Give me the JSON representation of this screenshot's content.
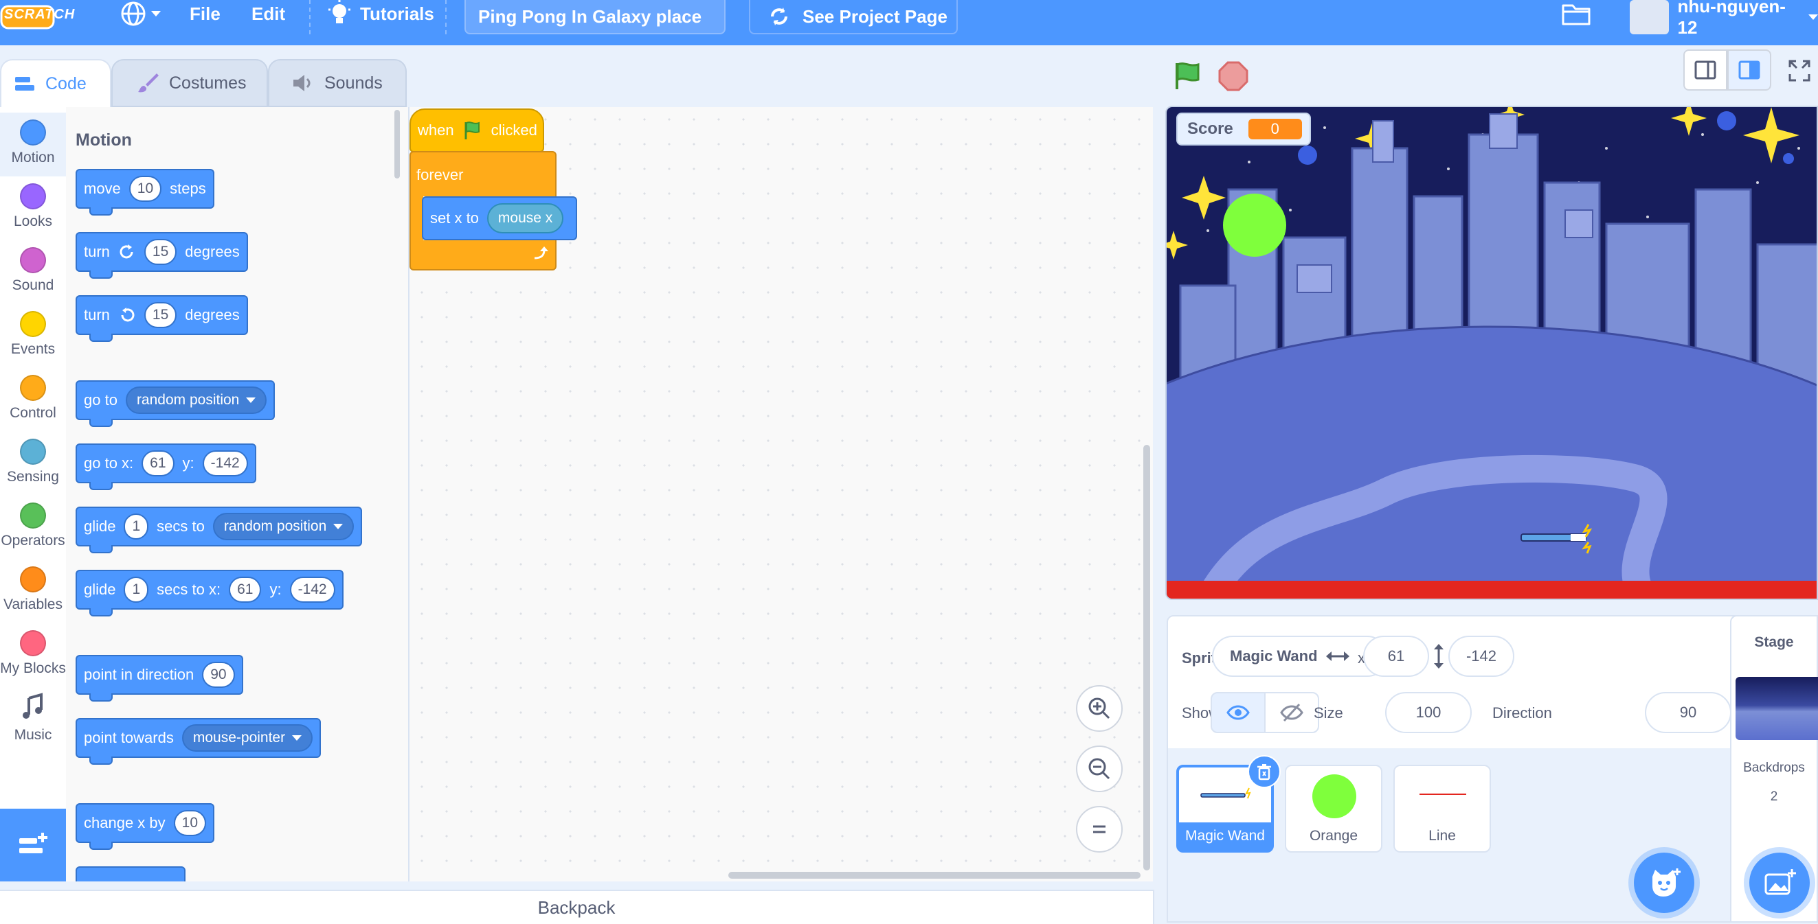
{
  "menu": {
    "logo": "SCRATCH",
    "file": "File",
    "edit": "Edit",
    "tutorials": "Tutorials",
    "project_title": "Ping Pong In Galaxy place",
    "see_project": "See Project Page",
    "username": "nhu-nguyen-12"
  },
  "tabs": {
    "code": "Code",
    "costumes": "Costumes",
    "sounds": "Sounds"
  },
  "categories": [
    {
      "label": "Motion",
      "color": "#4c97ff"
    },
    {
      "label": "Looks",
      "color": "#9966ff"
    },
    {
      "label": "Sound",
      "color": "#cf63cf"
    },
    {
      "label": "Events",
      "color": "#ffd500"
    },
    {
      "label": "Control",
      "color": "#ffab19"
    },
    {
      "label": "Sensing",
      "color": "#5cb1d6"
    },
    {
      "label": "Operators",
      "color": "#59c059"
    },
    {
      "label": "Variables",
      "color": "#ff8c1a"
    },
    {
      "label": "My Blocks",
      "color": "#ff6680"
    },
    {
      "label": "Music",
      "color": ""
    }
  ],
  "palette": {
    "title": "Motion",
    "move": {
      "a": "move",
      "n": "10",
      "b": "steps"
    },
    "turn_right": {
      "a": "turn",
      "n": "15",
      "b": "degrees"
    },
    "turn_left": {
      "a": "turn",
      "n": "15",
      "b": "degrees"
    },
    "goto": {
      "a": "go to",
      "opt": "random position"
    },
    "gotoxy": {
      "a": "go to x:",
      "x": "61",
      "b": "y:",
      "y": "-142"
    },
    "glide_to": {
      "a": "glide",
      "n": "1",
      "b": "secs to",
      "opt": "random position"
    },
    "glide_xy": {
      "a": "glide",
      "n": "1",
      "b": "secs to x:",
      "x": "61",
      "c": "y:",
      "y": "-142"
    },
    "point_dir": {
      "a": "point in direction",
      "n": "90"
    },
    "point_towards": {
      "a": "point towards",
      "opt": "mouse-pointer"
    },
    "change_x": {
      "a": "change x by",
      "n": "10"
    }
  },
  "script": {
    "when": "when",
    "clicked": "clicked",
    "forever": "forever",
    "setx": "set x to",
    "reporter": "mouse x"
  },
  "backpack": "Backpack",
  "stage": {
    "score_label": "Score",
    "score_value": "0"
  },
  "sprite_info": {
    "sprite_label": "Sprite",
    "sprite_name": "Magic Wand",
    "x_label": "x",
    "x": "61",
    "y_label": "y",
    "y": "-142",
    "show_label": "Show",
    "size_label": "Size",
    "size": "100",
    "direction_label": "Direction",
    "direction": "90"
  },
  "sprites": [
    {
      "name": "Magic Wand",
      "selected": true
    },
    {
      "name": "Orange",
      "selected": false
    },
    {
      "name": "Line",
      "selected": false
    }
  ],
  "stage_panel": {
    "title": "Stage",
    "backdrops_label": "Backdrops",
    "backdrops_count": "2"
  }
}
